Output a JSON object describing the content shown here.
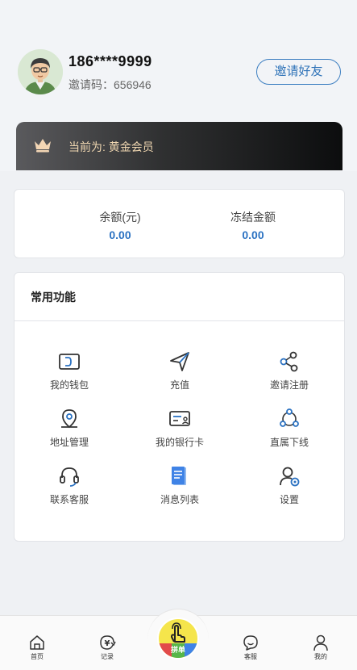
{
  "profile": {
    "phone": "186****9999",
    "invite_code": "邀请码：656946",
    "invite_button": "邀请好友"
  },
  "member": {
    "text": "当前为: 黄金会员",
    "icon": "crown-icon"
  },
  "balance": {
    "balance_label": "余额(元)",
    "balance_value": "0.00",
    "frozen_label": "冻结金额",
    "frozen_value": "0.00"
  },
  "functions": {
    "title": "常用功能",
    "items": [
      {
        "label": "我的钱包",
        "icon": "wallet-icon"
      },
      {
        "label": "充值",
        "icon": "send-icon"
      },
      {
        "label": "邀请注册",
        "icon": "share-icon"
      },
      {
        "label": "地址管理",
        "icon": "location-icon"
      },
      {
        "label": "我的银行卡",
        "icon": "bank-card-icon"
      },
      {
        "label": "直属下线",
        "icon": "network-icon"
      },
      {
        "label": "联系客服",
        "icon": "headset-icon"
      },
      {
        "label": "消息列表",
        "icon": "message-list-icon"
      },
      {
        "label": "设置",
        "icon": "settings-icon"
      }
    ]
  },
  "tabbar": {
    "items": [
      {
        "label": "首页",
        "icon": "home-icon"
      },
      {
        "label": "记录",
        "icon": "record-icon"
      },
      {
        "label": "拼单",
        "icon": "hand-tap-icon"
      },
      {
        "label": "客服",
        "icon": "chat-icon"
      },
      {
        "label": "我的",
        "icon": "user-icon"
      }
    ]
  },
  "colors": {
    "accent_blue": "#2b72c2",
    "gold_text": "#f0d7b1",
    "center_yellow": "#f5e54b"
  }
}
